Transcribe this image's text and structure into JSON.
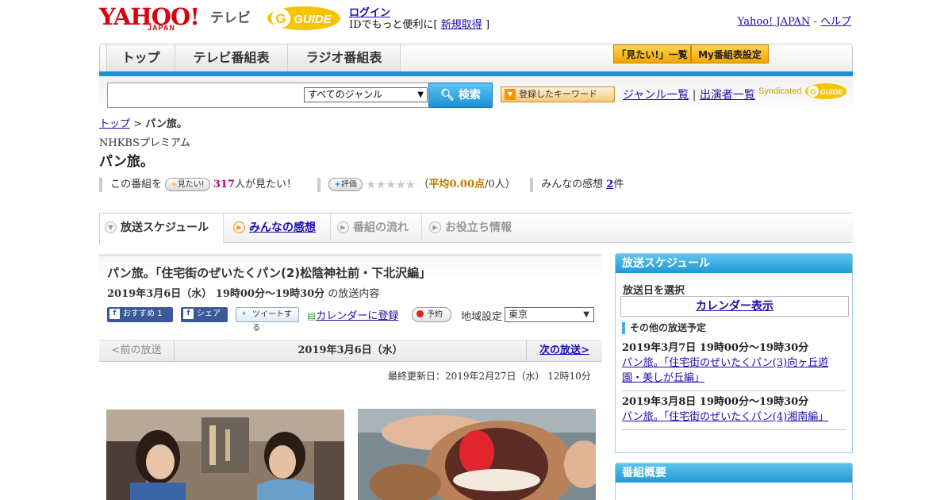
{
  "header": {
    "yahoo_logo": "YAHOO!",
    "japan_logo": "JAPAN",
    "tv_label": "テレビ",
    "gguide_logo": "G-GUIDE",
    "login_link": "ログイン",
    "login_sub_prefix": "IDでもっと便利に[",
    "signup_link": "新規取得",
    "login_sub_suffix": "]",
    "yahoo_japan_link": "Yahoo! JAPAN",
    "separator": "-",
    "help_link": "ヘルプ"
  },
  "nav": {
    "tabs": [
      {
        "label": "トップ"
      },
      {
        "label": "テレビ番組表"
      },
      {
        "label": "ラジオ番組表"
      }
    ],
    "wishlist_button": "「見たい!」一覧",
    "my_schedule_button": "My番組表設定"
  },
  "search": {
    "query": "",
    "genre_selected": "すべてのジャンル",
    "search_button": "検索",
    "keyword_button": "登録したキーワード",
    "genre_list_link": "ジャンル一覧",
    "link_separator": "|",
    "performer_list_link": "出演者一覧",
    "syndicated_label": "Syndicated"
  },
  "breadcrumb": {
    "top": "トップ",
    "separator": ">",
    "current": "パン旅。"
  },
  "program": {
    "channel": "NHKBSプレミアム",
    "title": "パン旅。",
    "want_prefix": "この番組を",
    "want_pill": "見たい!",
    "want_count": "317",
    "want_suffix": "人が見たい！",
    "rating_pill": "評価",
    "rating_stars": 0,
    "rating_open": "（",
    "rating_avg": "平均0.00点",
    "rating_count": "/0人",
    "rating_close": "）",
    "impressions_label": "みんなの感想",
    "impressions_count": "2",
    "impressions_unit": "件"
  },
  "subtabs": [
    {
      "label": "放送スケジュール"
    },
    {
      "label": "みんなの感想"
    },
    {
      "label": "番組の流れ"
    },
    {
      "label": "お役立ち情報"
    }
  ],
  "episode": {
    "title": "パン旅。「住宅街のぜいたくパン(2)松陰神社前・下北沢編」",
    "datetime": "2019年3月6日（水） 19時00分～19時30分",
    "datetime_suffix": "の放送内容",
    "fb_recommend": "おすすめ",
    "fb_recommend_count": "1",
    "fb_share": "シェア",
    "tweet": "ツイートする",
    "calendar_link": "カレンダーに登録",
    "reserve": "予約",
    "region_label": "地域設定",
    "region_selected": "東京",
    "prev_link": "<前の放送",
    "current_date": "2019年3月6日（水）",
    "next_link": "次の放送>",
    "updated": "最終更新日：2019年2月27日（水） 12時10分"
  },
  "sidebar": {
    "schedule_title": "放送スケジュール",
    "select_date_label": "放送日を選択",
    "calendar_button": "カレンダー表示",
    "other_title": "その他の放送予定",
    "other_items": [
      {
        "datetime": "2019年3月7日 19時00分～19時30分",
        "title": "パン旅。「住宅街のぜいたくパン(3)向ヶ丘遊園・美しが丘編」"
      },
      {
        "datetime": "2019年3月8日 19時00分～19時30分",
        "title": "パン旅。「住宅街のぜいたくパン(4)湘南編」"
      }
    ],
    "overview_title": "番組概要"
  },
  "colors": {
    "brand_red": "#d8000c",
    "accent_blue": "#1e8fd2",
    "gguide_yellow": "#f5c400",
    "want_count_color": "#c0006f",
    "rating_color": "#c07a00"
  }
}
